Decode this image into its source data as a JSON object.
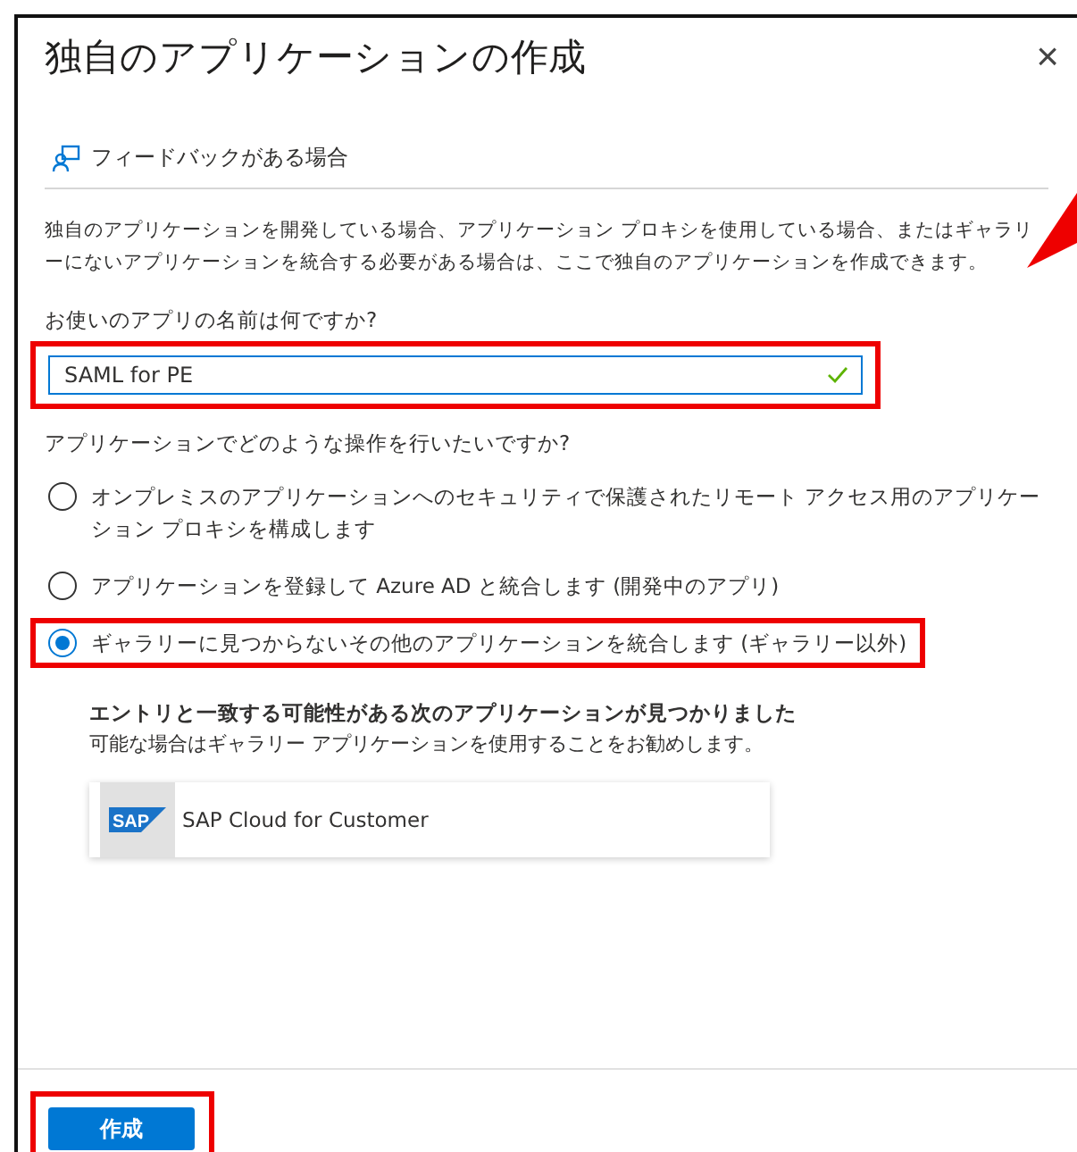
{
  "panel": {
    "title": "独自のアプリケーションの作成",
    "close": "×"
  },
  "feedback": {
    "label": "フィードバックがある場合"
  },
  "description": "独自のアプリケーションを開発している場合、アプリケーション プロキシを使用している場合、またはギャラリーにないアプリケーションを統合する必要がある場合は、ここで独自のアプリケーションを作成できます。",
  "name_field": {
    "label": "お使いのアプリの名前は何ですか?",
    "value": "SAML for PE",
    "valid": true,
    "highlighted": true
  },
  "question": "アプリケーションでどのような操作を行いたいですか?",
  "options": [
    {
      "label": "オンプレミスのアプリケーションへのセキュリティで保護されたリモート アクセス用のアプリケーション プロキシを構成します",
      "selected": false,
      "highlighted": false
    },
    {
      "label": "アプリケーションを登録して Azure AD と統合します (開発中のアプリ)",
      "selected": false,
      "highlighted": false
    },
    {
      "label": "ギャラリーに見つからないその他のアプリケーションを統合します (ギャラリー以外)",
      "selected": true,
      "highlighted": true
    }
  ],
  "suggestion": {
    "heading": "エントリと一致する可能性がある次のアプリケーションが見つかりました",
    "subtext": "可能な場合はギャラリー アプリケーションを使用することをお勧めします。",
    "apps": [
      {
        "logo": "SAP",
        "name": "SAP Cloud for Customer"
      }
    ]
  },
  "footer": {
    "create_button": "作成",
    "highlighted": true
  }
}
